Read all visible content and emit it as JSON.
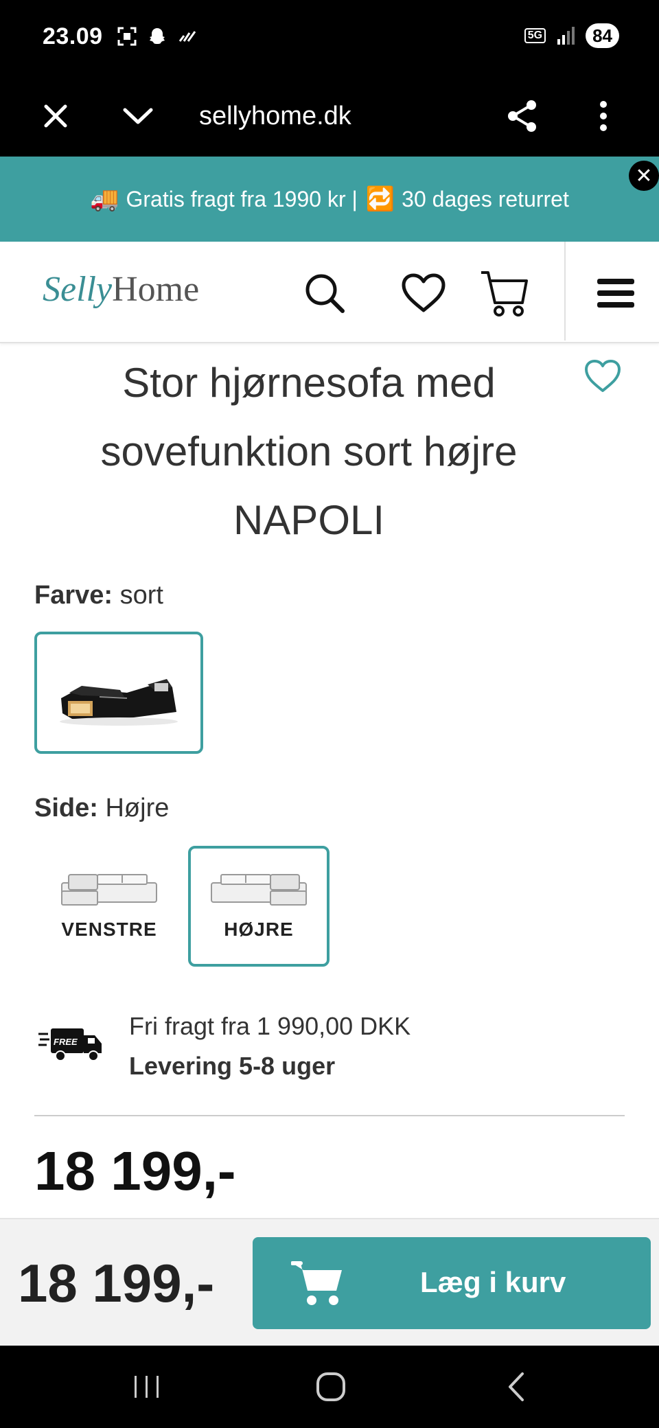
{
  "status": {
    "time": "23.09",
    "network": "5G",
    "battery": "84",
    "icons": [
      "screenshot-icon",
      "snapchat-icon",
      "wifi-calling-icon",
      "signal-icon"
    ]
  },
  "browser": {
    "url": "sellyhome.dk",
    "icons": [
      "close-icon",
      "chevron-down-icon",
      "share-icon",
      "more-vert-icon"
    ]
  },
  "promo": {
    "truck_emoji": "🚚",
    "text_part1": "Gratis fragt fra 1990 kr |",
    "return_emoji": "🔁",
    "text_part2": "30 dages returret",
    "close_label": "✕"
  },
  "header": {
    "logo_script": "Selly",
    "logo_plain": "Home",
    "icons": [
      "search-icon",
      "heart-icon",
      "cart-icon",
      "menu-icon"
    ]
  },
  "product": {
    "title": "Stor hjørnesofa med sovefunktion sort højre NAPOLI",
    "color_label": "Farve:",
    "color_value": "sort",
    "side_label": "Side:",
    "side_value": "Højre",
    "side_options": [
      {
        "label": "VENSTRE",
        "selected": false
      },
      {
        "label": "HØJRE",
        "selected": true
      }
    ],
    "shipping_free_badge": "FREE",
    "shipping_line1": "Fri fragt fra 1 990,00 DKK",
    "shipping_line2": "Levering 5-8 uger",
    "price": "18 199,-"
  },
  "sticky": {
    "price": "18 199,-",
    "add_to_cart": "Læg i kurv"
  },
  "colors": {
    "accent": "#3e9fa0",
    "text": "#333333"
  }
}
